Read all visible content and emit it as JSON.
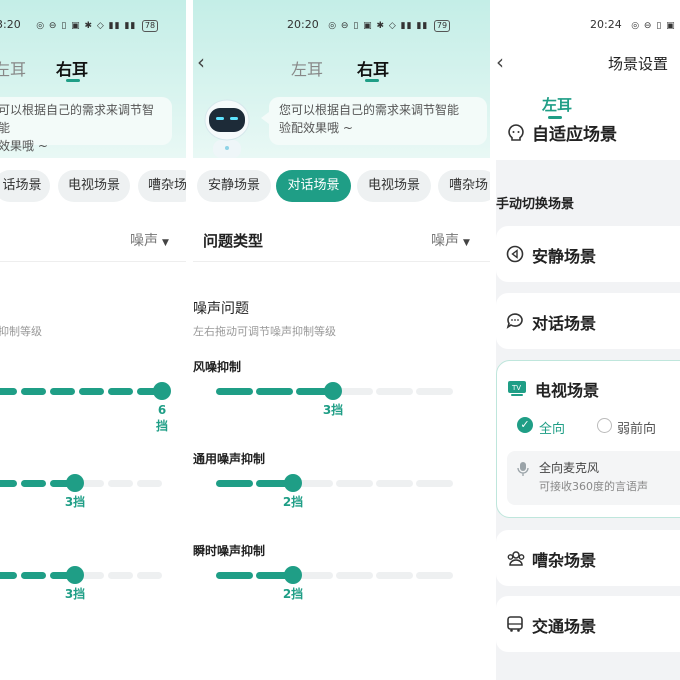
{
  "panel1": {
    "status_time": "3:20",
    "status_icons": "◎ ⊖ ▯ ▣ ✱ ◇ ▮▮ ▮▮",
    "battery": "78",
    "tabs": [
      "左耳",
      "右耳"
    ],
    "bubble_text": [
      "可以根据自己的需求来调节智能",
      "效果哦 ~"
    ],
    "chips": [
      "话场景",
      "电视场景",
      "嘈杂场"
    ],
    "row_value": "噪声",
    "section_sub": "抑制等级",
    "sliders": [
      {
        "label": "",
        "level": "6",
        "level_unit": "挡",
        "value": 6,
        "max": 6
      },
      {
        "label": "",
        "level": "3挡",
        "value": 3,
        "max": 6
      },
      {
        "label": "",
        "level": "3挡",
        "value": 3,
        "max": 6
      }
    ]
  },
  "panel2": {
    "status_time": "20:20",
    "status_icons": "◎ ⊖ ▯ ▣ ✱ ◇ ▮▮ ▮▮",
    "battery": "79",
    "tabs": [
      "左耳",
      "右耳"
    ],
    "bubble_text": [
      "您可以根据自己的需求来调节智能",
      "验配效果哦 ~"
    ],
    "chips": [
      "安静场景",
      "对话场景",
      "电视场景",
      "嘈杂场"
    ],
    "row_title": "问题类型",
    "row_value": "噪声",
    "section_title": "噪声问题",
    "section_sub": "左右拖动可调节噪声抑制等级",
    "sliders": [
      {
        "label": "风噪抑制",
        "level": "3挡",
        "value": 3,
        "max": 6
      },
      {
        "label": "通用噪声抑制",
        "level": "2挡",
        "value": 2,
        "max": 6
      },
      {
        "label": "瞬时噪声抑制",
        "level": "2挡",
        "value": 2,
        "max": 6
      }
    ]
  },
  "panel3": {
    "status_time": "20:24",
    "status_icons": "◎ ⊖ ▯ ▣",
    "title": "场景设置",
    "tab": "左耳",
    "adaptive": "自适应场景",
    "manual_title": "手动切换场景",
    "scenes": [
      "安静场景",
      "对话场景",
      "电视场景",
      "嘈杂场景",
      "交通场景"
    ],
    "tv_options": [
      "全向",
      "弱前向"
    ],
    "mic_title": "全向麦克风",
    "mic_desc": "可接收360度的言语声"
  },
  "colors": {
    "accent": "#1f9e86",
    "header_bg": "#c4eee7"
  }
}
